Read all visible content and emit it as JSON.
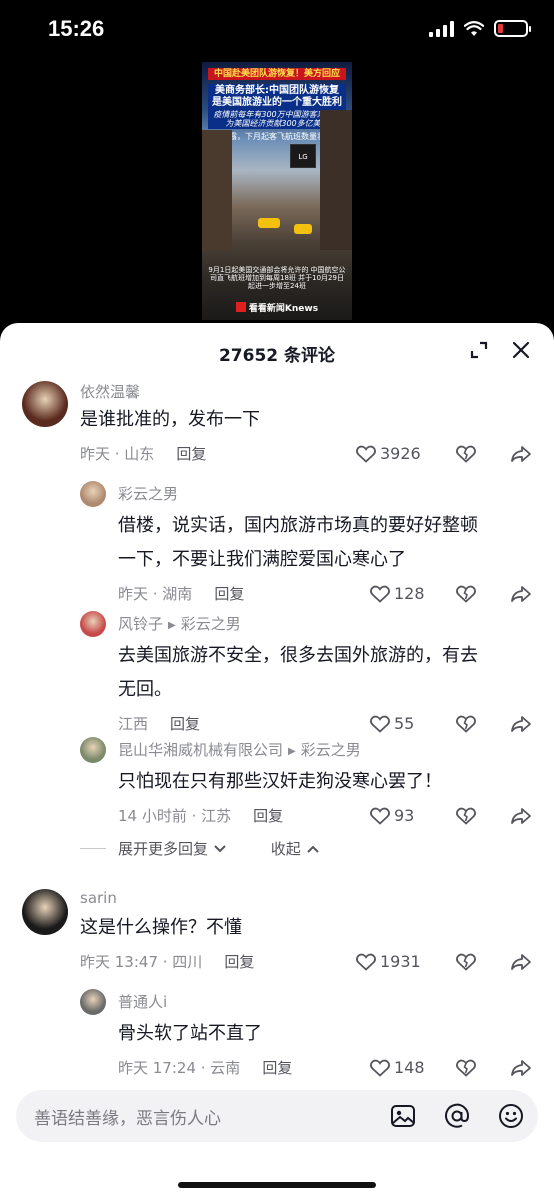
{
  "status": {
    "time": "15:26"
  },
  "video": {
    "banner1": "中国赴美团队游恢复！美方回应",
    "banner2": "美商务部长:中国团队游恢复 是美国旅游业的一个重大胜利",
    "banner3": "疫情前每年有300万中国游客来美国 为美国经济贡献300多亿美元",
    "banner4": "另透露，下月起客飞航班数量将翻倍",
    "sign": "LG",
    "caption": "9月1日起美国交通部会将允许的 中国航空公司直飞航班增加到每周18班 并于10月29日起进一步增至24班",
    "brand": "看看新闻Knews"
  },
  "sheet": {
    "title": "27652 条评论",
    "reply_label": "回复"
  },
  "comments": [
    {
      "user": "依然温馨",
      "text": [
        "是谁批准的，发布一下"
      ],
      "time": "昨天 · 山东",
      "likes": "3926"
    },
    {
      "user": "彩云之男",
      "text": [
        "借楼，说实话，国内旅游市场真的要好好整顿",
        "一下，不要让我们满腔爱国心寒心了"
      ],
      "time": "昨天 · 湖南",
      "likes": "128"
    },
    {
      "user": "风铃子",
      "reply_to": "彩云之男",
      "text": [
        "去美国旅游不安全，很多去国外旅游的，有去",
        "无回。"
      ],
      "time": "江西",
      "likes": "55"
    },
    {
      "user": "昆山华湘威机械有限公司",
      "reply_to": "彩云之男",
      "text": [
        "只怕现在只有那些汉奸走狗没寒心罢了！"
      ],
      "time": "14 小时前 · 江苏",
      "likes": "93"
    },
    {
      "user": "sarin",
      "text": [
        "这是什么操作？不懂"
      ],
      "time": "昨天 13:47 · 四川",
      "likes": "1931"
    },
    {
      "user": "普通人i",
      "text": [
        "骨头软了站不直了"
      ],
      "time": "昨天 17:24 · 云南",
      "likes": "148"
    }
  ],
  "expand": {
    "more": "展开更多回复",
    "collapse": "收起"
  },
  "input": {
    "placeholder": "善语结善缘，恶言伤人心"
  }
}
